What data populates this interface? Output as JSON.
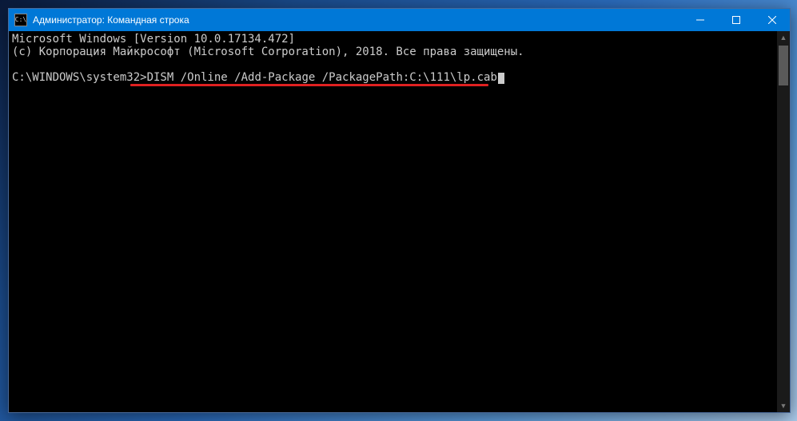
{
  "titlebar": {
    "icon_glyph": "C:\\",
    "title": "Администратор: Командная строка"
  },
  "window_controls": {
    "minimize_label": "Minimize",
    "maximize_label": "Maximize",
    "close_label": "Close"
  },
  "terminal": {
    "line1": "Microsoft Windows [Version 10.0.17134.472]",
    "line2": "(c) Корпорация Майкрософт (Microsoft Corporation), 2018. Все права защищены.",
    "blank": "",
    "prompt": "C:\\WINDOWS\\system32>",
    "command": "DISM /Online /Add-Package /PackagePath:C:\\111\\lp.cab"
  },
  "annotation": {
    "underline_color": "#e02020"
  }
}
